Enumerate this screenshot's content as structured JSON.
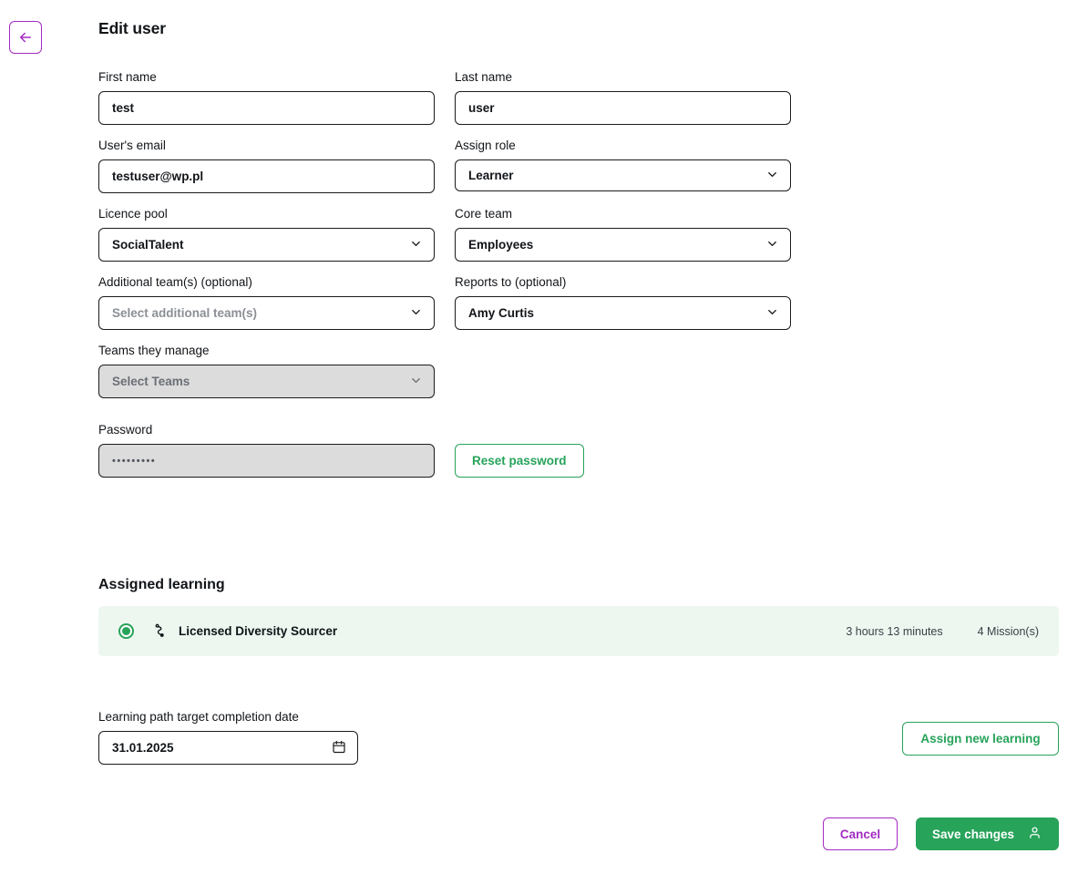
{
  "header": {
    "back_icon": "arrow-left-icon",
    "title": "Edit user"
  },
  "form": {
    "first_name": {
      "label": "First name",
      "value": "test"
    },
    "last_name": {
      "label": "Last name",
      "value": "user"
    },
    "email": {
      "label": "User's email",
      "value": "testuser@wp.pl"
    },
    "assign_role": {
      "label": "Assign role",
      "value": "Learner",
      "icon": "chevron-down-icon"
    },
    "licence_pool": {
      "label": "Licence pool",
      "value": "SocialTalent",
      "icon": "chevron-down-icon"
    },
    "core_team": {
      "label": "Core team",
      "value": "Employees",
      "icon": "chevron-down-icon"
    },
    "additional_teams": {
      "label": "Additional team(s) (optional)",
      "value": "",
      "placeholder": "Select additional team(s)",
      "icon": "chevron-down-icon"
    },
    "reports_to": {
      "label": "Reports to (optional)",
      "value": "Amy Curtis",
      "icon": "chevron-down-icon"
    },
    "teams_they_manage": {
      "label": "Teams they manage",
      "value": "",
      "placeholder": "Select Teams",
      "icon": "chevron-down-icon",
      "disabled": true
    },
    "password": {
      "label": "Password",
      "value": "•••••••••",
      "disabled": true
    },
    "reset_password_button": "Reset password"
  },
  "assigned_learning": {
    "section_title": "Assigned learning",
    "items": [
      {
        "selected": true,
        "icon": "learning-path-icon",
        "name": "Licensed Diversity Sourcer",
        "duration": "3 hours 13 minutes",
        "missions": "4 Mission(s)"
      }
    ]
  },
  "target_date": {
    "label": "Learning path target completion date",
    "value": "31.01.2025",
    "icon": "calendar-icon"
  },
  "actions": {
    "assign_new_learning": "Assign new learning",
    "cancel": "Cancel",
    "save_changes": "Save changes",
    "save_icon": "user-icon"
  },
  "colors": {
    "green": "#27a35a",
    "purple": "#a32bc4",
    "row_green_bg": "#edf7f0",
    "disabled_bg": "#dcdcdc",
    "border_dark": "#1b1b1b"
  }
}
